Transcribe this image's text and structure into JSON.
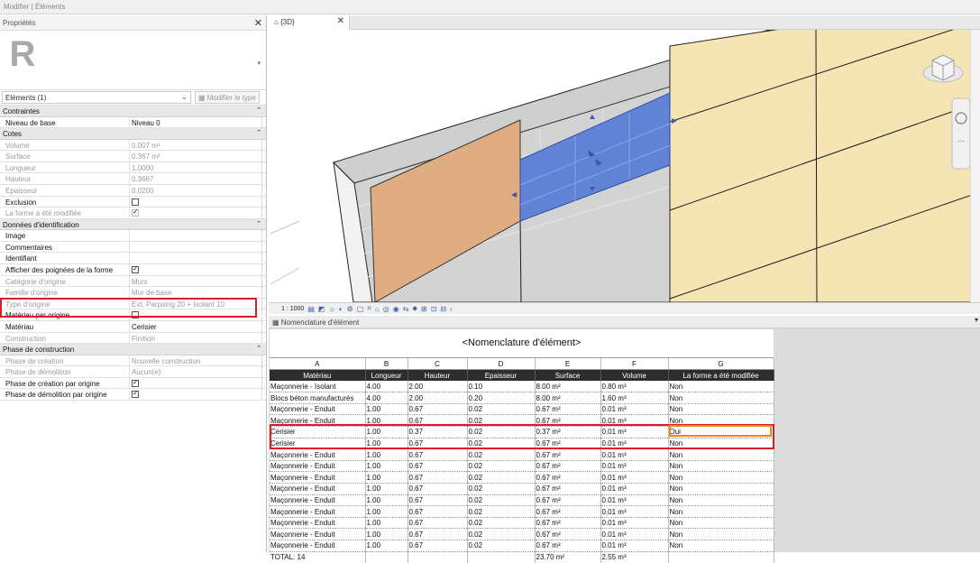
{
  "window": {
    "title": "Modifier | Éléments"
  },
  "properties": {
    "title": "Propriétés",
    "selector": "Eléments (1)",
    "edit_type": "Modifier le type",
    "sections": [
      {
        "title": "Contraintes",
        "rows": [
          {
            "key": "Niveau de base",
            "value": "Niveau 0",
            "disabled": false
          }
        ]
      },
      {
        "title": "Cotes",
        "rows": [
          {
            "key": "Volume",
            "value": "0.007 m³",
            "disabled": true
          },
          {
            "key": "Surface",
            "value": "0.367 m²",
            "disabled": true
          },
          {
            "key": "Longueur",
            "value": "1.0000",
            "disabled": true
          },
          {
            "key": "Hauteur",
            "value": "0.3667",
            "disabled": true
          },
          {
            "key": "Epaisseur",
            "value": "0.0200",
            "disabled": true
          },
          {
            "key": "Exclusion",
            "value": "",
            "checkbox": false,
            "disabled": false
          },
          {
            "key": "La forme a été modifiée",
            "value": "",
            "checkbox": true,
            "disabled": true
          }
        ]
      },
      {
        "title": "Données d'identification",
        "rows": [
          {
            "key": "Image",
            "value": "",
            "disabled": false
          },
          {
            "key": "Commentaires",
            "value": "",
            "disabled": false
          },
          {
            "key": "Identifiant",
            "value": "",
            "disabled": false
          },
          {
            "key": "Afficher des poignées de la forme",
            "value": "",
            "checkbox": true,
            "disabled": false
          },
          {
            "key": "Catégorie d'origine",
            "value": "Murs",
            "disabled": true
          },
          {
            "key": "Famille d'origine",
            "value": "Mur de base",
            "disabled": true
          },
          {
            "key": "Type d'origine",
            "value": "Ext. Parpaing 20 + Isolant 10",
            "disabled": true
          },
          {
            "key": "Matériau par origine",
            "value": "",
            "checkbox": false,
            "disabled": false
          },
          {
            "key": "Matériau",
            "value": "Cerisier",
            "disabled": false
          },
          {
            "key": "Construction",
            "value": "Finition",
            "disabled": true
          }
        ]
      },
      {
        "title": "Phase de construction",
        "rows": [
          {
            "key": "Phase de création",
            "value": "Nouvelle construction",
            "disabled": true
          },
          {
            "key": "Phase de démolition",
            "value": "Aucun(e)",
            "disabled": true
          },
          {
            "key": "Phase de création par origine",
            "value": "",
            "checkbox": true,
            "disabled": false
          },
          {
            "key": "Phase de démolition par origine",
            "value": "",
            "checkbox": true,
            "disabled": false
          }
        ]
      }
    ]
  },
  "view": {
    "tab_label": "{3D}",
    "scale": "1 : 1000"
  },
  "schedule": {
    "tab_label": "Nomenclature d'élément",
    "title": "<Nomenclature d'élément>",
    "letters": [
      "A",
      "B",
      "C",
      "D",
      "E",
      "F",
      "G"
    ],
    "headers": [
      "Matériau",
      "Longueur",
      "Hauteur",
      "Epaisseur",
      "Surface",
      "Volume",
      "La forme a été modifiée"
    ],
    "rows": [
      [
        "Maçonnerie - Isolant",
        "4.00",
        "2.00",
        "0.10",
        "8.00 m²",
        "0.80 m³",
        "Non"
      ],
      [
        "Blocs béton manufacturés",
        "4.00",
        "2.00",
        "0.20",
        "8.00 m²",
        "1.60 m³",
        "Non"
      ],
      [
        "Maçonnerie - Enduit",
        "1.00",
        "0.67",
        "0.02",
        "0.67 m²",
        "0.01 m³",
        "Non"
      ],
      [
        "Maçonnerie - Enduit",
        "1.00",
        "0.67",
        "0.02",
        "0.67 m²",
        "0.01 m³",
        "Non"
      ],
      [
        "Cerisier",
        "1.00",
        "0.37",
        "0.02",
        "0.37 m²",
        "0.01 m³",
        "Oui"
      ],
      [
        "Cerisier",
        "1.00",
        "0.67",
        "0.02",
        "0.67 m²",
        "0.01 m³",
        "Non"
      ],
      [
        "Maçonnerie - Enduit",
        "1.00",
        "0.67",
        "0.02",
        "0.67 m²",
        "0.01 m³",
        "Non"
      ],
      [
        "Maçonnerie - Enduit",
        "1.00",
        "0.67",
        "0.02",
        "0.67 m²",
        "0.01 m³",
        "Non"
      ],
      [
        "Maçonnerie - Enduit",
        "1.00",
        "0.67",
        "0.02",
        "0.67 m²",
        "0.01 m³",
        "Non"
      ],
      [
        "Maçonnerie - Enduit",
        "1.00",
        "0.67",
        "0.02",
        "0.67 m²",
        "0.01 m³",
        "Non"
      ],
      [
        "Maçonnerie - Enduit",
        "1.00",
        "0.67",
        "0.02",
        "0.67 m²",
        "0.01 m³",
        "Non"
      ],
      [
        "Maçonnerie - Enduit",
        "1.00",
        "0.67",
        "0.02",
        "0.67 m²",
        "0.01 m³",
        "Non"
      ],
      [
        "Maçonnerie - Enduit",
        "1.00",
        "0.67",
        "0.02",
        "0.67 m²",
        "0.01 m³",
        "Non"
      ],
      [
        "Maçonnerie - Enduit",
        "1.00",
        "0.67",
        "0.02",
        "0.67 m²",
        "0.01 m³",
        "Non"
      ],
      [
        "Maçonnerie - Enduit",
        "1.00",
        "0.67",
        "0.02",
        "0.67 m²",
        "0.01 m³",
        "Non"
      ]
    ],
    "total": [
      "TOTAL: 14",
      "",
      "",
      "",
      "23.70 m²",
      "2.55 m³",
      ""
    ]
  },
  "colors": {
    "highlight_red": "#d42026",
    "highlight_orange": "#e58b1e",
    "panel_selected": "#5b7fd6",
    "panel_cherry": "#e0ad82",
    "panel_wall": "#f5e5b4"
  }
}
